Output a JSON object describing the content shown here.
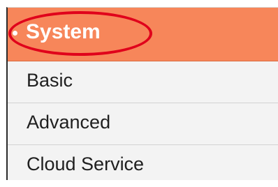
{
  "sidebar": {
    "title": "System",
    "items": [
      {
        "label": "Basic"
      },
      {
        "label": "Advanced"
      },
      {
        "label": "Cloud Service"
      }
    ]
  },
  "colors": {
    "header_background": "#f7865a",
    "highlight_annotation": "#e0001b",
    "menu_background": "#f3f3f3",
    "text": "#1f1f1f"
  },
  "icons": {
    "header_marker": "bullet-icon"
  }
}
